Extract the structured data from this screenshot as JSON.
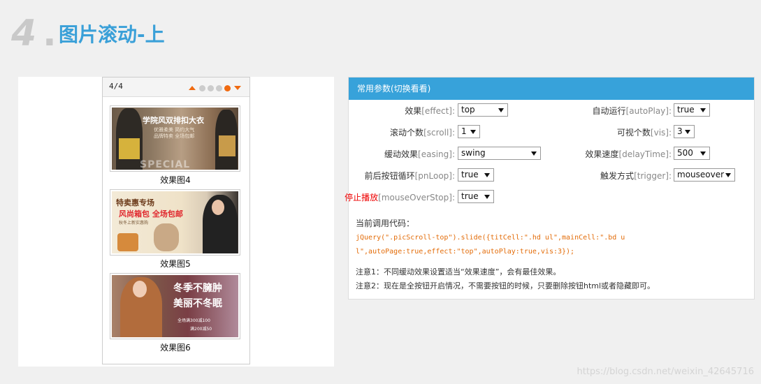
{
  "heading": {
    "number": "4",
    "dot": ".",
    "title": "图片滚动-上"
  },
  "scroller": {
    "page_count": "4/4",
    "dots": [
      false,
      false,
      false,
      false,
      true
    ],
    "items": [
      {
        "caption": "效果图4",
        "banner": {
          "brand": "学院风双排扣大衣",
          "sub1": "优雅柔美 简约大气",
          "sub2": "品牌特卖 全场包邮",
          "watermark": "SPECIAL"
        }
      },
      {
        "caption": "效果图5",
        "banner": {
          "t1": "特卖惠专场",
          "t2": "风尚箱包 全场包邮",
          "t3": "秋冬上新实惠购"
        }
      },
      {
        "caption": "效果图6",
        "banner": {
          "h1": "冬季不臃肿",
          "h2": "美丽不冬眠",
          "s1": "全场满300减100",
          "s2": "满200减50"
        }
      }
    ]
  },
  "params": {
    "header": "常用参数(切换看看)",
    "effect": {
      "cn": "效果",
      "en": "[effect]:",
      "value": "top"
    },
    "autoPlay": {
      "cn": "自动运行",
      "en": "[autoPlay]:",
      "value": "true"
    },
    "scroll": {
      "cn": "滚动个数",
      "en": "[scroll]:",
      "value": "1"
    },
    "vis": {
      "cn": "可视个数",
      "en": "[vis]:",
      "value": "3"
    },
    "easing": {
      "cn": "缓动效果",
      "en": "[easing]:",
      "value": "swing"
    },
    "delayTime": {
      "cn": "效果速度",
      "en": "[delayTime]:",
      "value": "500"
    },
    "pnLoop": {
      "cn": "前后按钮循环",
      "en": "[pnLoop]:",
      "value": "true"
    },
    "trigger": {
      "cn": "触发方式",
      "en": "[trigger]:",
      "value": "mouseover"
    },
    "mouseOverStop": {
      "cn": "停止播放",
      "en": "[mouseOverStop]:",
      "value": "true"
    },
    "code_title": "当前调用代码：",
    "code": "jQuery(\".picScroll-top\").slide({titCell:\".hd ul\",mainCell:\".bd ul\",autoPage:true,effect:\"top\",autoPlay:true,vis:3});",
    "note1": "注意1：不同缓动效果设置适当“效果速度”，会有最佳效果。",
    "note2": "注意2：现在是全按钮开启情况，不需要按钮的时候，只要删除按钮html或者隐藏即可。"
  },
  "watermark": "https://blog.csdn.net/weixin_42645716",
  "colors": {
    "accent": "#37a2da",
    "title": "#3aa0d8",
    "pager": "#f06a10",
    "code": "#e36c09",
    "alert": "#e00000"
  }
}
